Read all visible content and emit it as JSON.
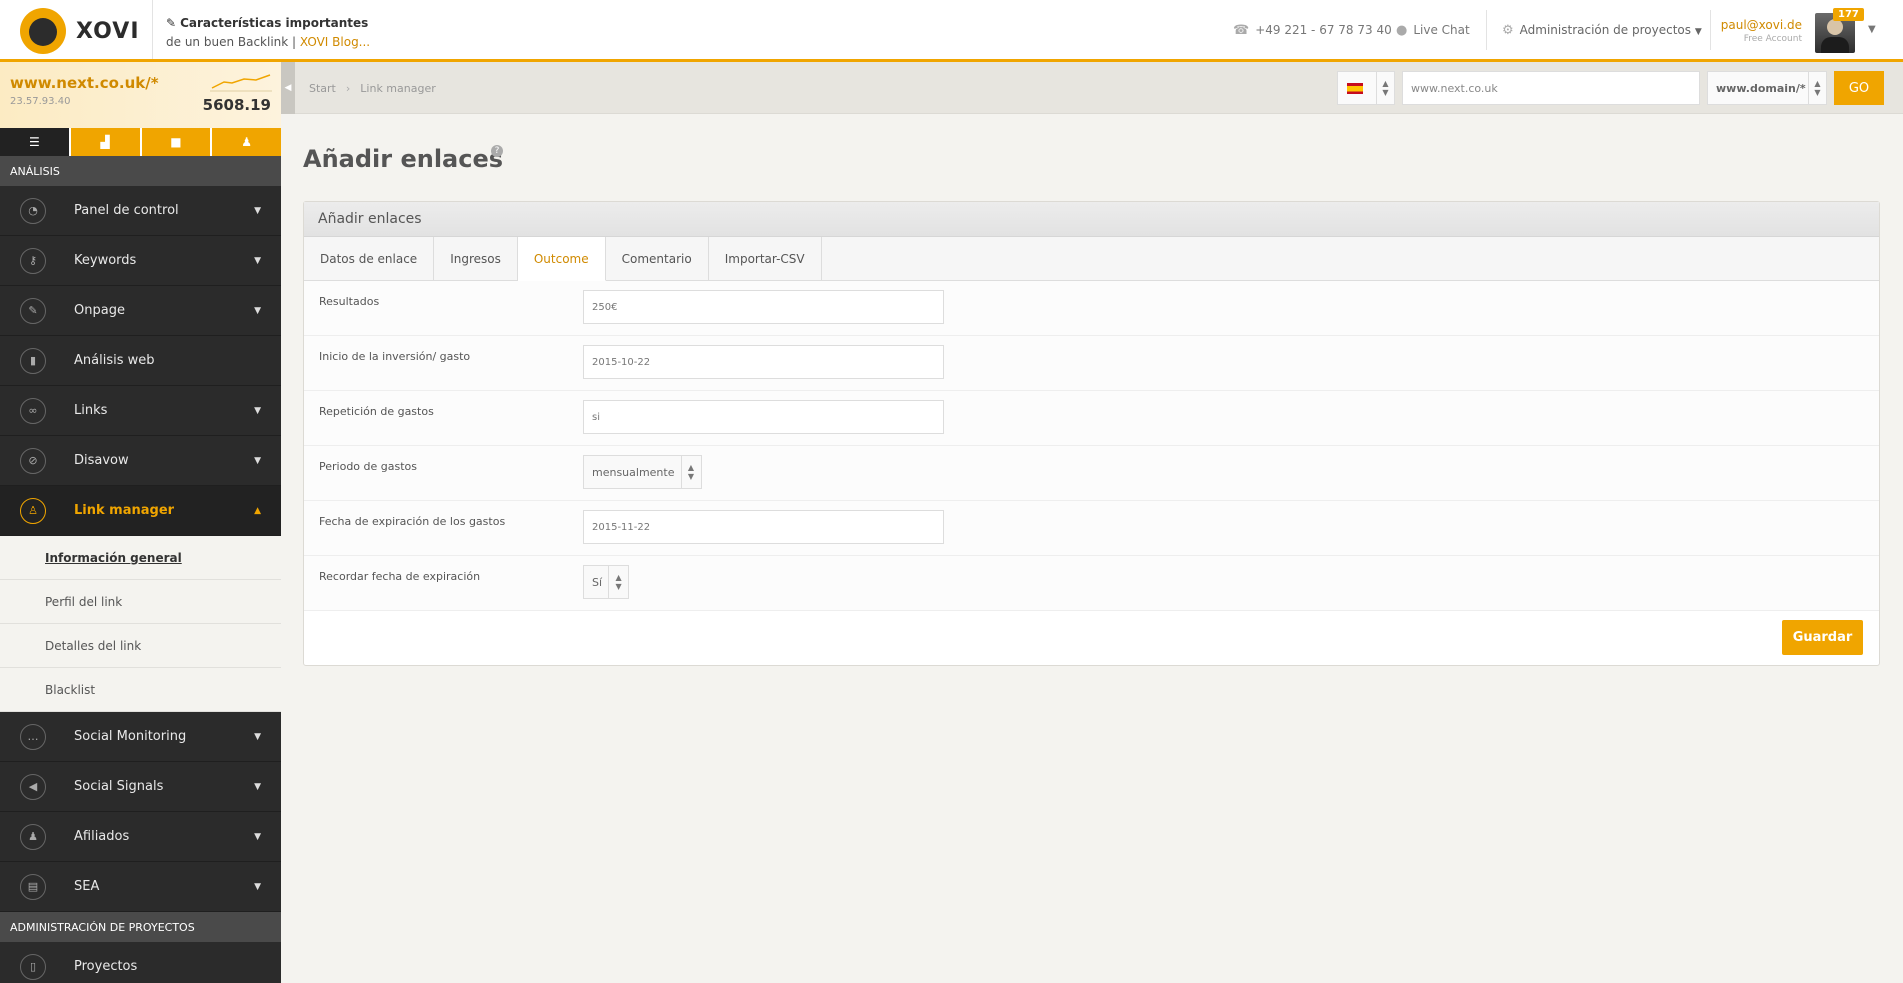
{
  "header": {
    "logo_text": "XOVI",
    "news_line1": "Características importantes",
    "news_line2_prefix": "de un buen Backlink |",
    "news_link": "XOVI Blog...",
    "phone": "+49 221 - 67 78 73 40",
    "live_chat": "Live Chat",
    "project_admin": "Administración de proyectos",
    "user_email": "paul@xovi.de",
    "user_plan": "Free Account",
    "notification_count": "177"
  },
  "sidebar": {
    "domain": "www.next.co.uk/*",
    "ip": "23.57.93.40",
    "score": "5608.19",
    "section_analysis": "ANÁLISIS",
    "items": [
      {
        "label": "Panel de control",
        "icon": "gauge-icon"
      },
      {
        "label": "Keywords",
        "icon": "key-icon"
      },
      {
        "label": "Onpage",
        "icon": "wrench-icon"
      },
      {
        "label": "Análisis web",
        "icon": "bar-chart-icon"
      },
      {
        "label": "Links",
        "icon": "chain-icon"
      },
      {
        "label": "Disavow",
        "icon": "broken-link-icon"
      },
      {
        "label": "Link manager",
        "icon": "link-manager-icon"
      }
    ],
    "subitems": [
      {
        "label": "Información general"
      },
      {
        "label": "Perfil del link"
      },
      {
        "label": "Detalles del link"
      },
      {
        "label": "Blacklist"
      }
    ],
    "items2": [
      {
        "label": "Social Monitoring",
        "icon": "speech-icon"
      },
      {
        "label": "Social Signals",
        "icon": "megaphone-icon"
      },
      {
        "label": "Afiliados",
        "icon": "people-icon"
      },
      {
        "label": "SEA",
        "icon": "sea-icon"
      }
    ],
    "section_projects": "ADMINISTRACIÓN DE PROYECTOS",
    "projects_item": {
      "label": "Proyectos",
      "icon": "clipboard-icon"
    }
  },
  "breadcrumb": {
    "start": "Start",
    "current": "Link manager"
  },
  "search": {
    "country": "ES",
    "url_value": "www.next.co.uk",
    "mode": "www.domain/*",
    "go_label": "GO"
  },
  "page": {
    "title": "Añadir enlaces",
    "panel_title": "Añadir enlaces",
    "tabs": [
      "Datos de enlace",
      "Ingresos",
      "Outcome",
      "Comentario",
      "Importar-CSV"
    ],
    "active_tab": "Outcome",
    "fields": {
      "resultados_label": "Resultados",
      "resultados_value": "250€",
      "inicio_label": "Inicio de la inversión/ gasto",
      "inicio_value": "2015-10-22",
      "repeticion_label": "Repetición de gastos",
      "repeticion_value": "si",
      "periodo_label": "Periodo de gastos",
      "periodo_value": "mensualmente",
      "expiracion_label": "Fecha de expiración de los gastos",
      "expiracion_value": "2015-11-22",
      "recordar_label": "Recordar fecha de expiración",
      "recordar_value": "Sí"
    },
    "save_label": "Guardar"
  },
  "colors": {
    "accent": "#f0a500",
    "sidebar_bg": "#2b2b2b",
    "page_bg": "#f4f3ef"
  }
}
